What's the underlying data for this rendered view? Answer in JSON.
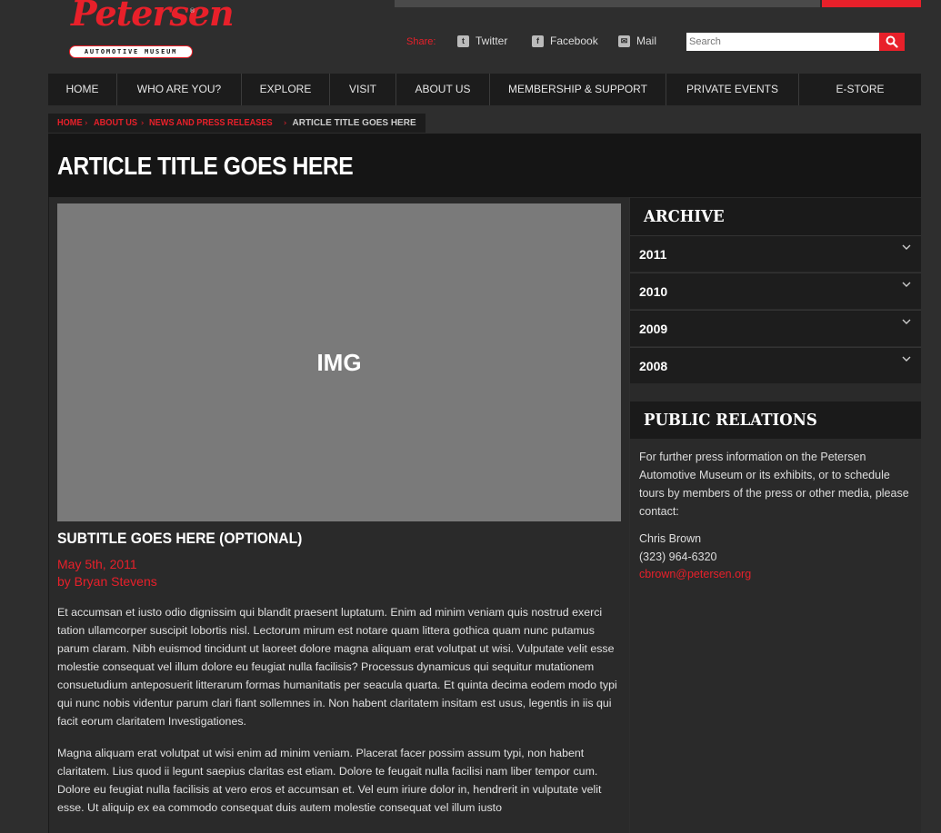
{
  "brand": {
    "logo_script": "Petersen",
    "logo_sub": "AUTOMOTIVE MUSEUM",
    "logo_reg": "®",
    "accent": "#e8202a"
  },
  "share": {
    "label": "Share:",
    "items": [
      {
        "label": "Twitter",
        "icon": "twitter-icon"
      },
      {
        "label": "Facebook",
        "icon": "facebook-icon"
      },
      {
        "label": "Mail",
        "icon": "mail-icon"
      }
    ]
  },
  "search": {
    "placeholder": "Search",
    "icon": "search-icon"
  },
  "nav": {
    "items": [
      {
        "label": "HOME"
      },
      {
        "label": "WHO ARE YOU?"
      },
      {
        "label": "EXPLORE"
      },
      {
        "label": "VISIT"
      },
      {
        "label": "ABOUT US"
      },
      {
        "label": "MEMBERSHIP & SUPPORT"
      },
      {
        "label": "PRIVATE EVENTS"
      },
      {
        "label": "E-STORE"
      }
    ]
  },
  "breadcrumb": {
    "links": [
      {
        "label": "HOME"
      },
      {
        "label": "ABOUT US"
      },
      {
        "label": "NEWS AND PRESS RELEASES"
      }
    ],
    "separator": "›",
    "current": "ARTICLE TITLE GOES HERE"
  },
  "article": {
    "title": "ARTICLE TITLE GOES HERE",
    "image_label": "IMG",
    "subtitle": "SUBTITLE GOES HERE (OPTIONAL)",
    "date": "May 5th, 2011",
    "byline": "by Bryan Stevens",
    "paragraphs": [
      "Et accumsan et iusto odio dignissim qui blandit praesent luptatum. Enim ad minim veniam quis nostrud exerci tation ullamcorper suscipit lobortis nisl. Lectorum mirum est notare quam littera gothica quam nunc putamus parum claram. Nibh euismod tincidunt ut laoreet dolore magna aliquam erat volutpat ut wisi. Vulputate velit esse molestie consequat vel illum dolore eu feugiat nulla facilisis? Processus dynamicus qui sequitur mutationem consuetudium anteposuerit litterarum formas humanitatis per seacula quarta. Et quinta decima eodem modo typi qui nunc nobis videntur parum clari fiant sollemnes in. Non habent claritatem insitam est usus, legentis in iis qui facit eorum claritatem Investigationes.",
      "Magna aliquam erat volutpat ut wisi enim ad minim veniam. Placerat facer possim assum typi, non habent claritatem. Lius quod ii legunt saepius claritas est etiam. Dolore te feugait nulla facilisi nam liber tempor cum. Dolore eu feugiat nulla facilisis at vero eros et accumsan et. Vel eum iriure dolor in, hendrerit in vulputate velit esse. Ut aliquip ex ea commodo consequat duis autem molestie consequat vel illum iusto"
    ]
  },
  "sidebar": {
    "archive_title": "ARCHIVE",
    "years": [
      "2011",
      "2010",
      "2009",
      "2008"
    ],
    "pr_title": "PUBLIC RELATIONS",
    "pr_text": "For further press information on the Petersen Automotive Museum or its exhibits, or to schedule tours by members of the press or other media, please contact:",
    "contact_name": "Chris Brown",
    "contact_phone": "(323) 964-6320",
    "contact_email": "cbrown@petersen.org"
  }
}
